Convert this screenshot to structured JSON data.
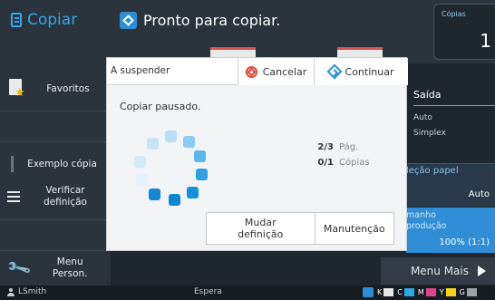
{
  "header": {
    "app_title": "Copiar",
    "status_message": "Pronto para copiar.",
    "copies_label": "Cópias",
    "copies_value": "1"
  },
  "sidebar": {
    "items": [
      {
        "label": "Favoritos",
        "icon": "favorites-icon"
      },
      {
        "label": "Exemplo cópia",
        "icon": "sample-copy-icon"
      },
      {
        "label": "Verificar definição",
        "icon": "list-icon"
      },
      {
        "label": "Menu Person.",
        "icon": "wrench-icon"
      }
    ]
  },
  "right_panel": {
    "output_title": "Saída",
    "output_lines": [
      "Auto",
      "Simplex"
    ],
    "paper_selection_label": "leção papel",
    "paper_selection_value": "Auto",
    "size_label": "manho produção",
    "size_value": "100% (1:1)",
    "more_menu_label": "Menu Mais"
  },
  "dialog": {
    "title": "A suspender",
    "cancel_label": "Cancelar",
    "continue_label": "Continuar",
    "message": "Copiar pausado.",
    "pages_count": "2/3",
    "pages_unit": "Pág.",
    "copies_count": "0/1",
    "copies_unit": "Cópias",
    "change_settings_label": "Mudar definição",
    "maintenance_label": "Manutenção"
  },
  "statusbar": {
    "user": "LSmith",
    "state": "Espera",
    "inks": [
      {
        "letter": "K",
        "color": "#e6e6e6"
      },
      {
        "letter": "C",
        "color": "#29a9e1"
      },
      {
        "letter": "M",
        "color": "#e0458a"
      },
      {
        "letter": "Y",
        "color": "#f2d31b"
      },
      {
        "letter": "G",
        "color": "#9aa3ab"
      }
    ]
  },
  "colors": {
    "accent": "#2d8fd6",
    "cancel": "#e0463a",
    "title": "#35a8e6"
  }
}
